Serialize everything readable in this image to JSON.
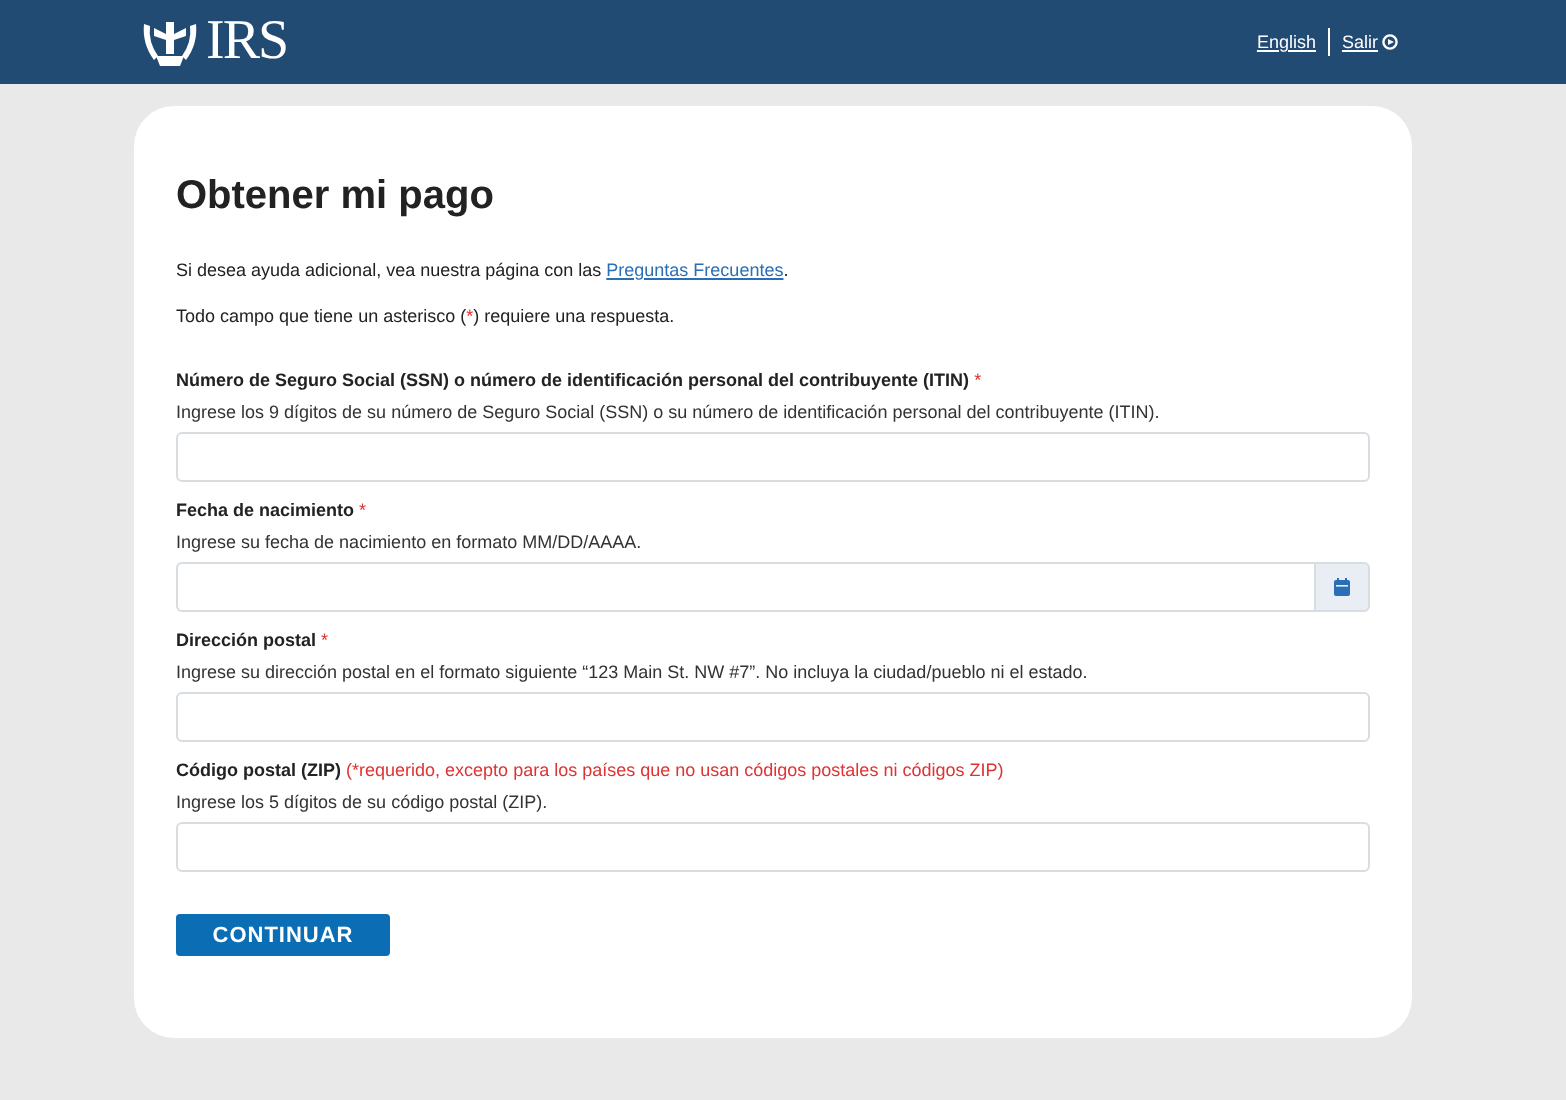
{
  "header": {
    "logo": "IRS",
    "links": [
      {
        "label": "English"
      },
      {
        "label": "Salir"
      }
    ]
  },
  "title": "Obtener mi pago",
  "intro": [
    [
      {
        "kind": "plain",
        "text": "Si desea ayuda adicional, vea nuestra página con las "
      },
      {
        "kind": "link",
        "text": "Preguntas Frecuentes"
      },
      {
        "kind": "plain",
        "text": "."
      }
    ],
    [
      {
        "kind": "plain",
        "text": "Todo campo que tiene un asterisco ("
      },
      {
        "kind": "required",
        "text": "*"
      },
      {
        "kind": "plain",
        "text": ") requiere una respuesta."
      }
    ]
  ],
  "fields": [
    {
      "kind": "text",
      "label": "Número de Seguro Social (SSN) o número de identificación personal del contribuyente (ITIN)",
      "mark": "*",
      "hint": "Ingrese los 9 dígitos de su número de Seguro Social (SSN) o su número de identificación personal del contribuyente (ITIN)."
    },
    {
      "kind": "date",
      "label": "Fecha de nacimiento",
      "mark": "*",
      "hint": "Ingrese su fecha de nacimiento en formato MM/DD/AAAA."
    },
    {
      "kind": "text",
      "label": "Dirección postal",
      "mark": "*",
      "hint": "Ingrese su dirección postal en el formato siguiente “123 Main St. NW #7”. No incluya la ciudad/pueblo ni el estado."
    },
    {
      "kind": "text",
      "label": "Código postal (ZIP)",
      "mark": "(*requerido, excepto para los países que no usan códigos postales ni códigos ZIP)",
      "hint": "Ingrese los 5 dígitos de su código postal (ZIP)."
    }
  ],
  "button": "CONTINUAR"
}
